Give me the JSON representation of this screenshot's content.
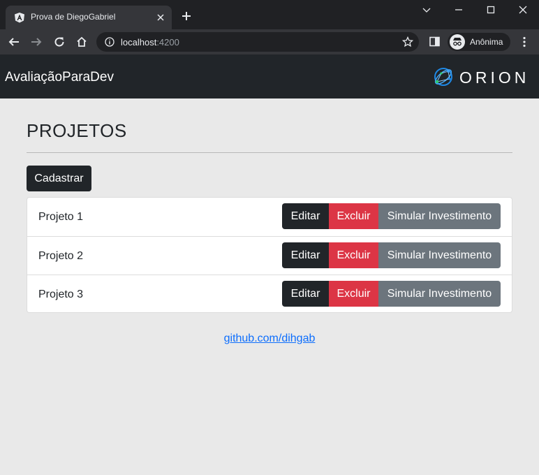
{
  "browser": {
    "tab_title": "Prova de DiegoGabriel",
    "url_host": "localhost",
    "url_port": ":4200",
    "profile_label": "Anônima"
  },
  "app": {
    "brand": "AvaliaçãoParaDev",
    "logo_text": "ORION"
  },
  "page": {
    "title": "PROJETOS",
    "create_label": "Cadastrar"
  },
  "projects": [
    {
      "name": "Projeto 1",
      "edit": "Editar",
      "delete": "Excluir",
      "simulate": "Simular Investimento"
    },
    {
      "name": "Projeto 2",
      "edit": "Editar",
      "delete": "Excluir",
      "simulate": "Simular Investimento"
    },
    {
      "name": "Projeto 3",
      "edit": "Editar",
      "delete": "Excluir",
      "simulate": "Simular Investimento"
    }
  ],
  "footer": {
    "link_text": "github.com/dihgab"
  },
  "colors": {
    "navbar": "#212529",
    "danger": "#dc3545",
    "secondary": "#6c757d",
    "link": "#0d6efd"
  }
}
